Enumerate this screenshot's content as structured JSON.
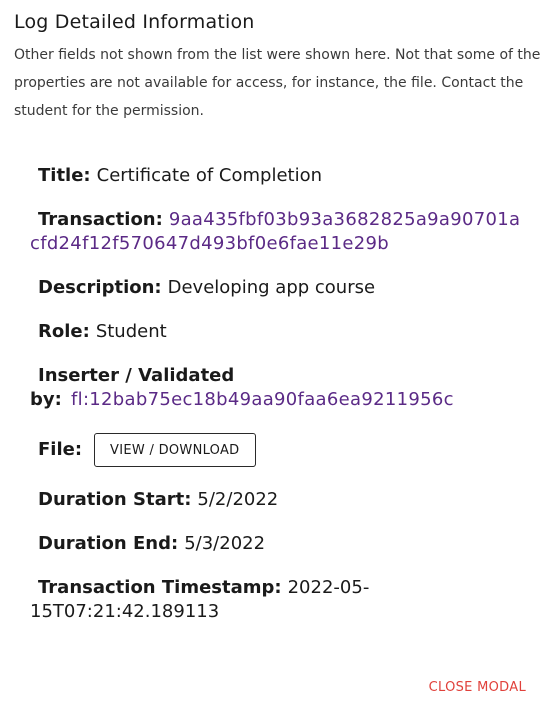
{
  "modal": {
    "title": "Log Detailed Information",
    "note": "Other fields not shown from the list were shown here. Not that some of the properties are not available for access, for instance, the file. Contact the student for the permission.",
    "close_label": "CLOSE MODAL"
  },
  "fields": {
    "title": {
      "label": "Title:",
      "value": "Certificate of Completion"
    },
    "transaction": {
      "label": "Transaction:",
      "value": "9aa435fbf03b93a3682825a9a90701acfd24f12f570647d493bf0e6fae11e29b"
    },
    "description": {
      "label": "Description:",
      "value": "Developing app course"
    },
    "role": {
      "label": "Role:",
      "value": "Student"
    },
    "inserter": {
      "label": "Inserter / Validated by:",
      "value": "fl:12bab75ec18b49aa90faa6ea9211956c"
    },
    "file": {
      "label": "File:",
      "button_label": "VIEW / DOWNLOAD"
    },
    "duration_start": {
      "label": "Duration Start:",
      "value": "5/2/2022"
    },
    "duration_end": {
      "label": "Duration End:",
      "value": "5/3/2022"
    },
    "timestamp": {
      "label": "Transaction Timestamp:",
      "value": "2022-05-15T07:21:42.189113"
    }
  },
  "colors": {
    "hash_text": "#5b2a86",
    "close_button": "#e0413b"
  }
}
